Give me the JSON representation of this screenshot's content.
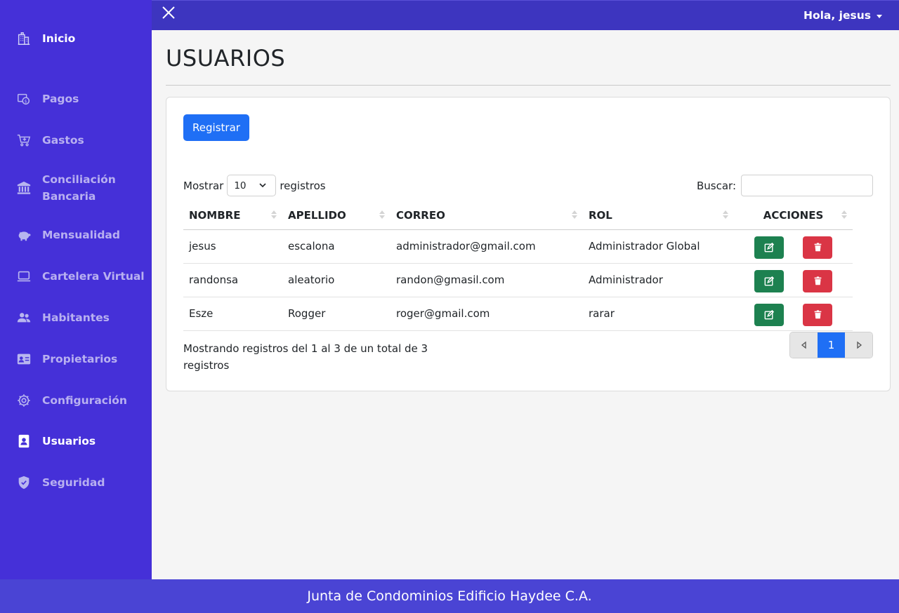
{
  "sidebar": {
    "items": [
      {
        "label": "Inicio",
        "icon": "building-icon"
      },
      {
        "label": "Pagos",
        "icon": "payment-icon"
      },
      {
        "label": "Gastos",
        "icon": "cart-icon"
      },
      {
        "label": "Conciliación Bancaria",
        "icon": "bank-icon"
      },
      {
        "label": "Mensualidad",
        "icon": "piggy-bank-icon"
      },
      {
        "label": "Cartelera Virtual",
        "icon": "laptop-icon"
      },
      {
        "label": "Habitantes",
        "icon": "users-icon"
      },
      {
        "label": "Propietarios",
        "icon": "id-card-icon"
      },
      {
        "label": "Configuración",
        "icon": "gear-icon"
      },
      {
        "label": "Usuarios",
        "icon": "user-badge-icon"
      },
      {
        "label": "Seguridad",
        "icon": "shield-icon"
      }
    ],
    "item_line2": {
      "bank": "Bancaria"
    },
    "item_line1": {
      "bank": "Conciliación"
    }
  },
  "topbar": {
    "user_greeting": "Hola, jesus"
  },
  "page": {
    "title": "USUARIOS"
  },
  "card": {
    "register_label": "Registrar",
    "length": {
      "prefix": "Mostrar",
      "value": "10",
      "suffix": "registros"
    },
    "search": {
      "label": "Buscar:",
      "value": ""
    },
    "table": {
      "columns": [
        "NOMBRE",
        "APELLIDO",
        "CORREO",
        "ROL",
        "ACCIONES"
      ],
      "rows": [
        {
          "nombre": "jesus",
          "apellido": "escalona",
          "correo": "administrador@gmail.com",
          "rol": "Administrador Global"
        },
        {
          "nombre": "randonsa",
          "apellido": "aleatorio",
          "correo": "randon@gmasil.com",
          "rol": "Administrador"
        },
        {
          "nombre": "Esze",
          "apellido": "Rogger",
          "correo": "roger@gmail.com",
          "rol": "rarar"
        }
      ]
    },
    "info": "Mostrando registros del 1 al 3 de un total de 3 registros",
    "pagination": {
      "current": "1"
    }
  },
  "footer": {
    "text": "Junta de Condominios Edificio Haydee C.A."
  },
  "colors": {
    "sidebar": "#4530d8",
    "topbar": "#3d35bf",
    "primary": "#1f6ff5",
    "success": "#1d8150",
    "danger": "#da3545"
  }
}
